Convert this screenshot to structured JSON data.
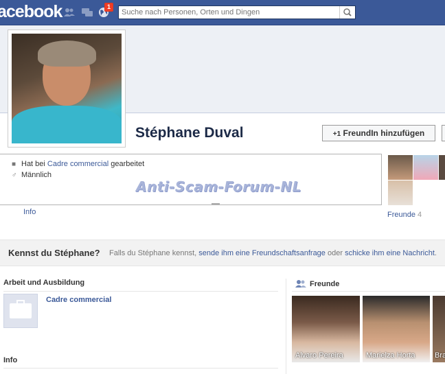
{
  "header": {
    "logo": "acebook",
    "notification_count": "1",
    "search_placeholder": "Suche nach Personen, Orten und Dingen"
  },
  "profile": {
    "name": "Stéphane Duval",
    "add_friend_label": "FreundIn hinzufügen",
    "work_prefix": "Hat bei ",
    "work_link": "Cadre commercial",
    "work_suffix": " gearbeitet",
    "gender": "Männlich",
    "info_tab": "Info",
    "friends_label": "Freunde",
    "friends_count": "4"
  },
  "watermark": "Anti-Scam-Forum-NL",
  "know_bar": {
    "question": "Kennst du Stéphane?",
    "text_1": "Falls du Stéphane kennst, ",
    "link_1": "sende ihm eine Freundschaftsanfrage",
    "text_2": " oder ",
    "link_2": "schicke ihm eine Nachricht",
    "text_3": "."
  },
  "work_section": {
    "title": "Arbeit und Ausbildung",
    "employer": "Cadre commercial"
  },
  "info_section": {
    "title": "Info"
  },
  "friends_section": {
    "title": "Freunde",
    "friends": [
      {
        "name": "Alvaro Pereira"
      },
      {
        "name": "Marielza Horta"
      },
      {
        "name": "Bra"
      }
    ]
  },
  "colors": {
    "brand": "#3b5998",
    "link": "#3b5998",
    "badge": "#f03d25"
  }
}
